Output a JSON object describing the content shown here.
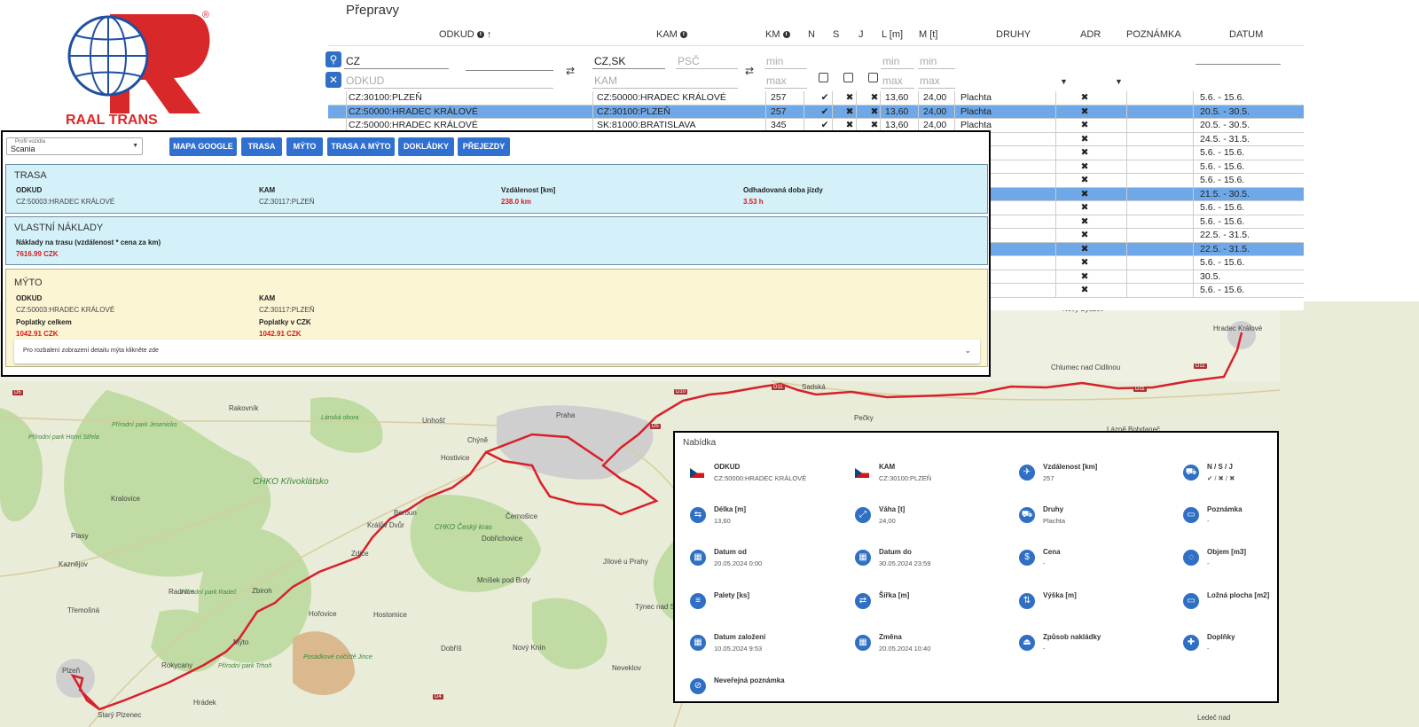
{
  "preprava_title": "Přepravy",
  "columns": {
    "odkud": "ODKUD",
    "kam": "KAM",
    "km": "KM",
    "n": "N",
    "s": "S",
    "j": "J",
    "l": "L [m]",
    "m": "M [t]",
    "druhy": "DRUHY",
    "adr": "ADR",
    "poznamka": "POZNÁMKA",
    "datum": "DATUM"
  },
  "filters": {
    "odkud_value": "CZ",
    "odkud_ph": "ODKUD",
    "kam_value": "CZ,SK",
    "kam_ph": "KAM",
    "psc_ph": "PSČ",
    "min_ph": "min",
    "max_ph": "max"
  },
  "rows": [
    {
      "odkud": "CZ:30100:PLZEŇ",
      "kam": "CZ:50000:HRADEC KRÁLOVÉ",
      "km": "257",
      "n": "✔",
      "s": "✖",
      "j": "✖",
      "l": "13,60",
      "m": "24,00",
      "druhy": "Plachta",
      "adr": "✖",
      "datum": "5.6. - 15.6.",
      "sel": false
    },
    {
      "odkud": "CZ:50000:HRADEC KRÁLOVÉ",
      "kam": "CZ:30100:PLZEŇ",
      "km": "257",
      "n": "✔",
      "s": "✖",
      "j": "✖",
      "l": "13,60",
      "m": "24,00",
      "druhy": "Plachta",
      "adr": "✖",
      "datum": "20.5. - 30.5.",
      "sel": true
    },
    {
      "odkud": "CZ:50000:HRADEC KRÁLOVÉ",
      "kam": "SK:81000:BRATISLAVA",
      "km": "345",
      "n": "✔",
      "s": "✖",
      "j": "✖",
      "l": "13,60",
      "m": "24,00",
      "druhy": "Plachta",
      "adr": "✖",
      "datum": "20.5. - 30.5.",
      "sel": false
    },
    {
      "adr": "✖",
      "datum": "24.5. - 31.5.",
      "sel": false
    },
    {
      "adr": "✖",
      "datum": "5.6. - 15.6.",
      "sel": false
    },
    {
      "adr": "✖",
      "datum": "5.6. - 15.6.",
      "sel": false
    },
    {
      "adr": "✖",
      "datum": "5.6. - 15.6.",
      "sel": false
    },
    {
      "adr": "✖",
      "datum": "21.5. - 30.5.",
      "sel": true
    },
    {
      "adr": "✖",
      "datum": "5.6. - 15.6.",
      "sel": false
    },
    {
      "adr": "✖",
      "datum": "5.6. - 15.6.",
      "sel": false
    },
    {
      "adr": "✖",
      "datum": "22.5. - 31.5.",
      "sel": false
    },
    {
      "adr": "✖",
      "datum": "22.5. - 31.5.",
      "sel": true
    },
    {
      "adr": "✖",
      "datum": "5.6. - 15.6.",
      "sel": false
    },
    {
      "adr": "✖",
      "datum": "30.5.",
      "sel": false
    },
    {
      "adr": "✖",
      "datum": "5.6. - 15.6.",
      "sel": false
    }
  ],
  "panel": {
    "profile_label": "Profil vozidla",
    "profile_value": "Scania",
    "buttons": [
      "MAPA GOOGLE",
      "TRASA",
      "MÝTO",
      "TRASA A MÝTO",
      "DOKLÁDKY",
      "PŘEJEZDY"
    ],
    "trasa": {
      "title": "TRASA",
      "odkud_l": "ODKUD",
      "odkud_v": "CZ:50003:HRADEC KRÁLOVÉ",
      "kam_l": "KAM",
      "kam_v": "CZ:30117:PLZEŇ",
      "vzd_l": "Vzdálenost [km]",
      "vzd_v": "238.0 km",
      "doba_l": "Odhadovaná doba jízdy",
      "doba_v": "3.53 h"
    },
    "naklady": {
      "title": "VLASTNÍ NÁKLADY",
      "label": "Náklady na trasu (vzdálenost * cena za km)",
      "value": "7616.99 CZK"
    },
    "myto": {
      "title": "MÝTO",
      "odkud_l": "ODKUD",
      "odkud_v": "CZ:50003:HRADEC KRÁLOVÉ",
      "kam_l": "KAM",
      "kam_v": "CZ:30117:PLZEŇ",
      "pc_l": "Poplatky celkem",
      "pc_v": "1042.91 CZK",
      "pczk_l": "Poplatky v CZK",
      "pczk_v": "1042.91 CZK",
      "acc": "Pro rozbalení zobrazení detailu mýta klikněte zde"
    }
  },
  "nabidka": {
    "title": "Nabídka",
    "items": [
      {
        "icon": "flag-cz",
        "label": "ODKUD",
        "value": "CZ:50000:HRADEC KRÁLOVÉ"
      },
      {
        "icon": "flag-cz",
        "label": "KAM",
        "value": "CZ:30100:PLZEŇ"
      },
      {
        "icon": "airplane-icon",
        "label": "Vzdálenost [km]",
        "value": "257"
      },
      {
        "icon": "truck-icon",
        "label": "N / S / J",
        "value": "✔ / ✖ / ✖"
      },
      {
        "icon": "length-icon",
        "label": "Délka [m]",
        "value": "13,60"
      },
      {
        "icon": "weight-icon",
        "label": "Váha [t]",
        "value": "24,00"
      },
      {
        "icon": "truck-icon",
        "label": "Druhy",
        "value": "Plachta"
      },
      {
        "icon": "note-icon",
        "label": "Poznámka",
        "value": "-"
      },
      {
        "icon": "calendar-icon",
        "label": "Datum od",
        "value": "20.05.2024 0:00"
      },
      {
        "icon": "calendar-icon",
        "label": "Datum do",
        "value": "30.05.2024 23:59"
      },
      {
        "icon": "price-icon",
        "label": "Cena",
        "value": "-"
      },
      {
        "icon": "volume-icon",
        "label": "Objem [m3]",
        "value": "-"
      },
      {
        "icon": "pallet-icon",
        "label": "Palety [ks]",
        "value": ""
      },
      {
        "icon": "width-icon",
        "label": "Šířka [m]",
        "value": ""
      },
      {
        "icon": "height-icon",
        "label": "Výška [m]",
        "value": ""
      },
      {
        "icon": "area-icon",
        "label": "Ložná plocha [m2]",
        "value": ""
      },
      {
        "icon": "calendar-icon",
        "label": "Datum založení",
        "value": "10.05.2024 9:53"
      },
      {
        "icon": "calendar-icon",
        "label": "Změna",
        "value": "20.05.2024 10:40"
      },
      {
        "icon": "loading-icon",
        "label": "Způsob nakládky",
        "value": "-"
      },
      {
        "icon": "extras-icon",
        "label": "Doplňky",
        "value": "-"
      },
      {
        "icon": "private-note-icon",
        "label": "Neveřejná poznámka",
        "value": ""
      }
    ]
  },
  "map_labels": [
    {
      "t": "Hradec Králové"
    },
    {
      "t": "Nový Bydžov"
    },
    {
      "t": "Chlumec nad Cidlinou"
    },
    {
      "t": "Praha"
    },
    {
      "t": "Rakovník"
    },
    {
      "t": "Unhošť"
    },
    {
      "t": "Hostivice"
    },
    {
      "t": "Chýně"
    },
    {
      "t": "Kralovice"
    },
    {
      "t": "Plasy"
    },
    {
      "t": "Kaznějov"
    },
    {
      "t": "Třemošná"
    },
    {
      "t": "Plzeň"
    },
    {
      "t": "Rokycany"
    },
    {
      "t": "Radnice"
    },
    {
      "t": "Zbiroh"
    },
    {
      "t": "Hořovice"
    },
    {
      "t": "Hostomice"
    },
    {
      "t": "Beroun"
    },
    {
      "t": "Králův Dvůr"
    },
    {
      "t": "Zdice"
    },
    {
      "t": "Mýto"
    },
    {
      "t": "Černošice"
    },
    {
      "t": "Dobřichovice"
    },
    {
      "t": "Jílové u Prahy"
    },
    {
      "t": "Mníšek pod Brdy"
    },
    {
      "t": "Nový Knín"
    },
    {
      "t": "Dobříš"
    },
    {
      "t": "Týnec nad Sázavou"
    },
    {
      "t": "Neveklov"
    },
    {
      "t": "Hrádek"
    },
    {
      "t": "Starý Plzenec"
    },
    {
      "t": "Sadská"
    },
    {
      "t": "Pečky"
    },
    {
      "t": "Lázně Bohdaneč"
    },
    {
      "t": "Ledeč nad"
    }
  ],
  "map_green": [
    {
      "t": "CHKO Křivoklátsko"
    },
    {
      "t": "CHKO Český kras"
    },
    {
      "t": "Přírodní park Jesenicko"
    },
    {
      "t": "Přírodní park Horní Střela"
    },
    {
      "t": "Přírodní park Radeč"
    },
    {
      "t": "Přírodní park Trhoň"
    },
    {
      "t": "Lánská obora"
    },
    {
      "t": "Posádkové cvičiště Jince"
    }
  ],
  "roads": [
    "D6",
    "D10",
    "D11",
    "D11",
    "D11",
    "D4",
    "D5"
  ]
}
